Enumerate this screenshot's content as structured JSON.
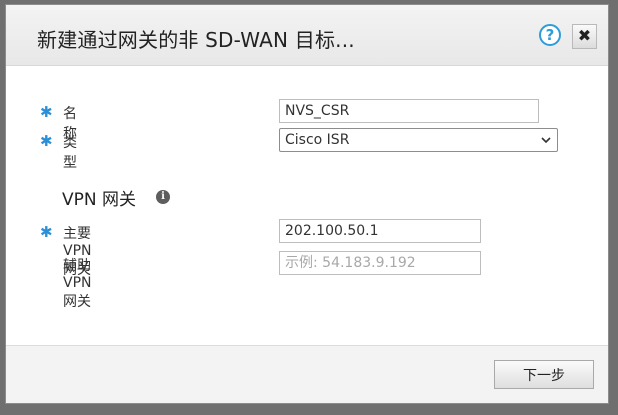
{
  "dialog": {
    "title": "新建通过网关的非 SD-WAN 目标...",
    "help_icon": "?",
    "close_icon": "✖"
  },
  "form": {
    "name": {
      "required_mark": "✱",
      "label": "名称",
      "value": "NVS_CSR"
    },
    "type": {
      "required_mark": "✱",
      "label": "类型",
      "selected": "Cisco ISR"
    }
  },
  "vpn_section": {
    "title": "VPN 网关",
    "info_icon": "i",
    "primary": {
      "required_mark": "✱",
      "label": "主要 VPN 网关",
      "value": "202.100.50.1"
    },
    "secondary": {
      "label": "辅助 VPN 网关",
      "value": "",
      "placeholder": "示例: 54.183.9.192"
    }
  },
  "footer": {
    "next_label": "下一步"
  },
  "colors": {
    "required_accent": "#2a8fd6",
    "help_accent": "#2d9cdb"
  }
}
